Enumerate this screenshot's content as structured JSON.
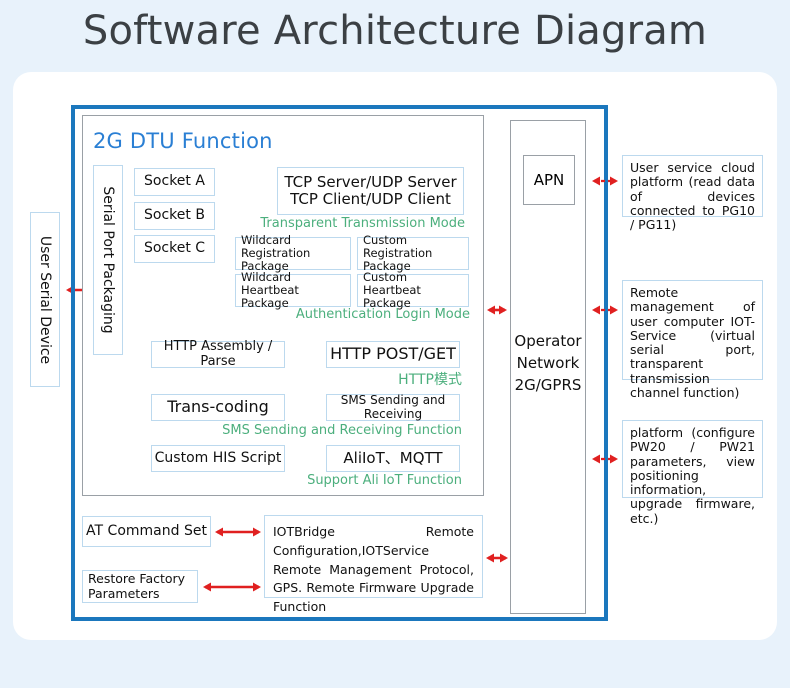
{
  "page": {
    "title": "Software Architecture Diagram",
    "background_color": "#e8f2fb",
    "card_color": "#ffffff",
    "frame_color": "#1b77bd",
    "accent_blue": "#2a7fd4",
    "accent_green": "#4caf7d",
    "arrow_color": "#e02020",
    "box_border_color": "#bcd9ee",
    "panel_border_color": "#9aa0a6"
  },
  "dtu": {
    "heading": "2G DTU Function",
    "serial_port_packaging": "Serial Port Packaging",
    "sockets": [
      {
        "label": "Socket A"
      },
      {
        "label": "Socket B"
      },
      {
        "label": "Socket C"
      }
    ],
    "transparent": {
      "line1": "TCP Server/UDP Server",
      "line2": "TCP Client/UDP Client",
      "mode_label": "Transparent Transmission Mode"
    },
    "auth": {
      "wildcard_registration": "Wildcard Registration Package",
      "custom_registration": "Custom Registration Package",
      "wildcard_heartbeat": "Wildcard Heartbeat Package",
      "custom_heartbeat": "Custom Heartbeat Package",
      "mode_label": "Authentication Login Mode"
    },
    "http": {
      "assembly": "HTTP Assembly / Parse",
      "post_get": "HTTP POST/GET",
      "mode_label": "HTTP模式"
    },
    "sms": {
      "trans_coding": "Trans-coding",
      "sending_receiving": "SMS Sending and Receiving",
      "mode_label": "SMS Sending and Receiving Function"
    },
    "ali": {
      "custom_script": "Custom HIS Script",
      "aliiot_mqtt": "AliIoT、MQTT",
      "mode_label": "Support Ali IoT Function"
    }
  },
  "left": {
    "user_serial_device": "User Serial Device"
  },
  "operator": {
    "apn": "APN",
    "network_line1": "Operator",
    "network_line2": "Network",
    "network_line3": "2G/GPRS"
  },
  "right_boxes": [
    {
      "text": "User service cloud platform (read data of devices connected to PG10 / PG11)"
    },
    {
      "text": "Remote management of user computer IOT-Service (virtual serial port, transparent transmission channel function)"
    },
    {
      "text": "platform (configure PW20 / PW21 parameters, view positioning information, upgrade firmware, etc.)"
    }
  ],
  "bottom": {
    "at_command_set": "AT Command Set",
    "restore_factory_parameters": "Restore Factory Parameters",
    "iotbridge": "IOTBridge Remote Configuration,IOTService Remote Management Protocol, GPS. Remote Firmware Upgrade Function"
  }
}
